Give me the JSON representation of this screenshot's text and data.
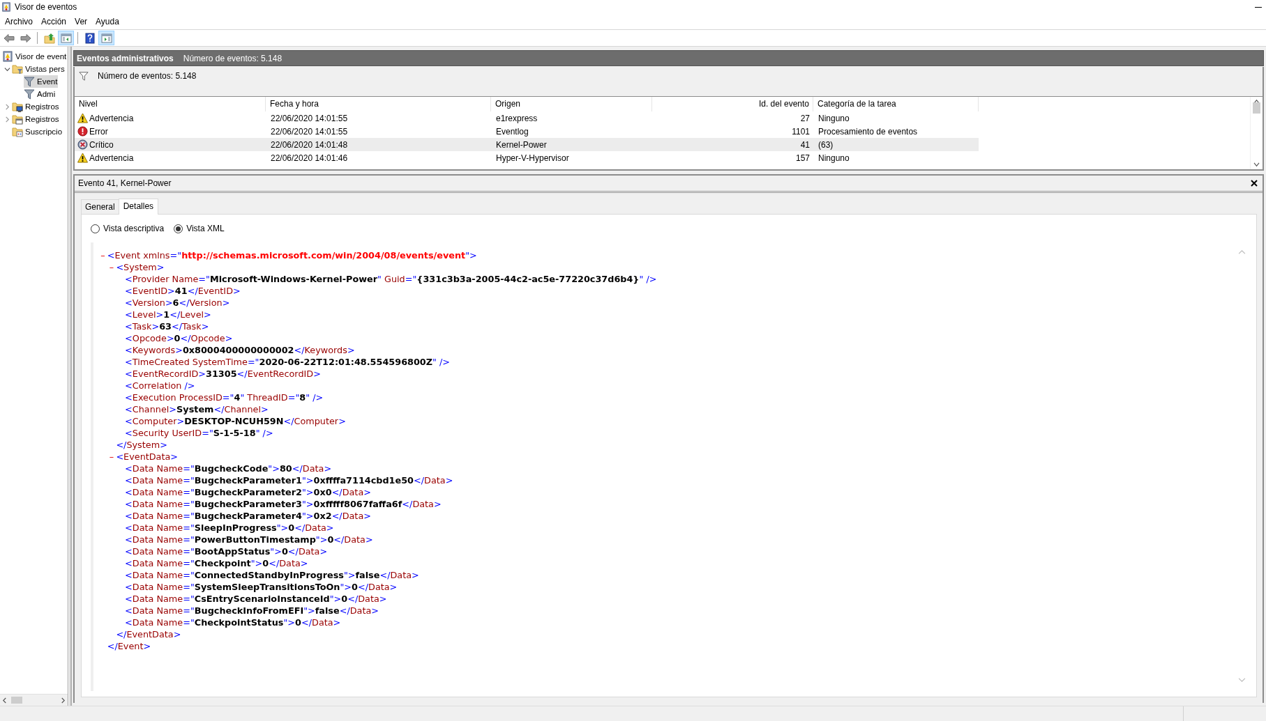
{
  "window": {
    "title": "Visor de eventos"
  },
  "menu": [
    "Archivo",
    "Acción",
    "Ver",
    "Ayuda"
  ],
  "toolbar": [
    {
      "kind": "back",
      "pressed": false
    },
    {
      "kind": "forward",
      "pressed": false
    },
    {
      "kind": "separator"
    },
    {
      "kind": "folder-up",
      "pressed": false
    },
    {
      "kind": "panel-left",
      "pressed": true
    },
    {
      "kind": "separator"
    },
    {
      "kind": "help",
      "pressed": false
    },
    {
      "kind": "panel-right",
      "pressed": true
    }
  ],
  "sidebar": {
    "items": [
      {
        "label": "Visor de event",
        "kind": "viewer",
        "selected": false,
        "children": [
          {
            "label": "Vistas pers",
            "kind": "folder-filter",
            "expanded": true,
            "selected": false,
            "children": [
              {
                "label": "Event",
                "kind": "filter",
                "selected": true
              },
              {
                "label": "Admi",
                "kind": "filter",
                "selected": false
              }
            ]
          },
          {
            "label": "Registros",
            "kind": "folder-log",
            "expanded": false,
            "selected": false
          },
          {
            "label": "Registros",
            "kind": "folder-window",
            "expanded": false,
            "selected": false
          },
          {
            "label": "Suscripcio",
            "kind": "folder-sub",
            "selected": false
          }
        ]
      }
    ]
  },
  "view_header": {
    "title": "Eventos administrativos",
    "count": "Número de eventos: 5.148"
  },
  "filter_bar": {
    "text": "Número de eventos: 5.148"
  },
  "table": {
    "columns": [
      "Nivel",
      "Fecha y hora",
      "Origen",
      "Id. del evento",
      "Categoría de la tarea"
    ],
    "rows": [
      {
        "kind": "warning",
        "selected": false,
        "cells": [
          "Advertencia",
          "22/06/2020 14:01:55",
          "e1rexpress",
          "27",
          "Ninguno"
        ]
      },
      {
        "kind": "error",
        "selected": false,
        "cells": [
          "Error",
          "22/06/2020 14:01:55",
          "Eventlog",
          "1101",
          "Procesamiento de eventos"
        ]
      },
      {
        "kind": "critical",
        "selected": true,
        "cells": [
          "Crítico",
          "22/06/2020 14:01:48",
          "Kernel-Power",
          "41",
          "(63)"
        ]
      },
      {
        "kind": "warning",
        "selected": false,
        "cells": [
          "Advertencia",
          "22/06/2020 14:01:46",
          "Hyper-V-Hypervisor",
          "157",
          "Ninguno"
        ]
      }
    ]
  },
  "detail": {
    "title": "Evento 41, Kernel-Power",
    "tabs": [
      {
        "label": "General",
        "selected": false
      },
      {
        "label": "Detalles",
        "selected": true
      }
    ],
    "views": [
      {
        "label": "Vista descriptiva",
        "selected": false
      },
      {
        "label": "Vista XML",
        "selected": true
      }
    ],
    "xml": {
      "toggle": "–",
      "expanded": true,
      "open": [
        {
          "kind": "mark",
          "text": "<"
        },
        {
          "kind": "name",
          "text": "Event xmlns"
        },
        {
          "kind": "mark",
          "text": "=\""
        },
        {
          "kind": "url",
          "text": "http://schemas.microsoft.com/win/2004/08/events/event"
        },
        {
          "kind": "mark",
          "text": "\">"
        }
      ],
      "close": [
        {
          "kind": "mark",
          "text": "</"
        },
        {
          "kind": "name",
          "text": "Event"
        },
        {
          "kind": "mark",
          "text": ">"
        }
      ],
      "children": [
        {
          "toggle": "–",
          "expanded": true,
          "open": [
            {
              "kind": "mark",
              "text": "<"
            },
            {
              "kind": "name",
              "text": "System"
            },
            {
              "kind": "mark",
              "text": ">"
            }
          ],
          "close": [
            {
              "kind": "mark",
              "text": "</"
            },
            {
              "kind": "name",
              "text": "System"
            },
            {
              "kind": "mark",
              "text": ">"
            }
          ],
          "children": [
            {
              "line": [
                {
                  "kind": "mark",
                  "text": "<"
                },
                {
                  "kind": "name",
                  "text": "Provider Name"
                },
                {
                  "kind": "mark",
                  "text": "=\""
                },
                {
                  "kind": "value",
                  "text": "Microsoft-Windows-Kernel-Power"
                },
                {
                  "kind": "mark",
                  "text": "\" "
                },
                {
                  "kind": "name",
                  "text": "Guid"
                },
                {
                  "kind": "mark",
                  "text": "=\""
                },
                {
                  "kind": "value",
                  "text": "{331c3b3a-2005-44c2-ac5e-77220c37d6b4}"
                },
                {
                  "kind": "mark",
                  "text": "\" />"
                }
              ]
            },
            {
              "line": [
                {
                  "kind": "mark",
                  "text": "<"
                },
                {
                  "kind": "name",
                  "text": "EventID"
                },
                {
                  "kind": "mark",
                  "text": ">"
                },
                {
                  "kind": "value",
                  "text": "41"
                },
                {
                  "kind": "mark",
                  "text": "</"
                },
                {
                  "kind": "name",
                  "text": "EventID"
                },
                {
                  "kind": "mark",
                  "text": ">"
                }
              ]
            },
            {
              "line": [
                {
                  "kind": "mark",
                  "text": "<"
                },
                {
                  "kind": "name",
                  "text": "Version"
                },
                {
                  "kind": "mark",
                  "text": ">"
                },
                {
                  "kind": "value",
                  "text": "6"
                },
                {
                  "kind": "mark",
                  "text": "</"
                },
                {
                  "kind": "name",
                  "text": "Version"
                },
                {
                  "kind": "mark",
                  "text": ">"
                }
              ]
            },
            {
              "line": [
                {
                  "kind": "mark",
                  "text": "<"
                },
                {
                  "kind": "name",
                  "text": "Level"
                },
                {
                  "kind": "mark",
                  "text": ">"
                },
                {
                  "kind": "value",
                  "text": "1"
                },
                {
                  "kind": "mark",
                  "text": "</"
                },
                {
                  "kind": "name",
                  "text": "Level"
                },
                {
                  "kind": "mark",
                  "text": ">"
                }
              ]
            },
            {
              "line": [
                {
                  "kind": "mark",
                  "text": "<"
                },
                {
                  "kind": "name",
                  "text": "Task"
                },
                {
                  "kind": "mark",
                  "text": ">"
                },
                {
                  "kind": "value",
                  "text": "63"
                },
                {
                  "kind": "mark",
                  "text": "</"
                },
                {
                  "kind": "name",
                  "text": "Task"
                },
                {
                  "kind": "mark",
                  "text": ">"
                }
              ]
            },
            {
              "line": [
                {
                  "kind": "mark",
                  "text": "<"
                },
                {
                  "kind": "name",
                  "text": "Opcode"
                },
                {
                  "kind": "mark",
                  "text": ">"
                },
                {
                  "kind": "value",
                  "text": "0"
                },
                {
                  "kind": "mark",
                  "text": "</"
                },
                {
                  "kind": "name",
                  "text": "Opcode"
                },
                {
                  "kind": "mark",
                  "text": ">"
                }
              ]
            },
            {
              "line": [
                {
                  "kind": "mark",
                  "text": "<"
                },
                {
                  "kind": "name",
                  "text": "Keywords"
                },
                {
                  "kind": "mark",
                  "text": ">"
                },
                {
                  "kind": "value",
                  "text": "0x8000400000000002"
                },
                {
                  "kind": "mark",
                  "text": "</"
                },
                {
                  "kind": "name",
                  "text": "Keywords"
                },
                {
                  "kind": "mark",
                  "text": ">"
                }
              ]
            },
            {
              "line": [
                {
                  "kind": "mark",
                  "text": "<"
                },
                {
                  "kind": "name",
                  "text": "TimeCreated SystemTime"
                },
                {
                  "kind": "mark",
                  "text": "=\""
                },
                {
                  "kind": "value",
                  "text": "2020-06-22T12:01:48.554596800Z"
                },
                {
                  "kind": "mark",
                  "text": "\" />"
                }
              ]
            },
            {
              "line": [
                {
                  "kind": "mark",
                  "text": "<"
                },
                {
                  "kind": "name",
                  "text": "EventRecordID"
                },
                {
                  "kind": "mark",
                  "text": ">"
                },
                {
                  "kind": "value",
                  "text": "31305"
                },
                {
                  "kind": "mark",
                  "text": "</"
                },
                {
                  "kind": "name",
                  "text": "EventRecordID"
                },
                {
                  "kind": "mark",
                  "text": ">"
                }
              ]
            },
            {
              "line": [
                {
                  "kind": "mark",
                  "text": "<"
                },
                {
                  "kind": "name",
                  "text": "Correlation"
                },
                {
                  "kind": "mark",
                  "text": " />"
                }
              ]
            },
            {
              "line": [
                {
                  "kind": "mark",
                  "text": "<"
                },
                {
                  "kind": "name",
                  "text": "Execution ProcessID"
                },
                {
                  "kind": "mark",
                  "text": "=\""
                },
                {
                  "kind": "value",
                  "text": "4"
                },
                {
                  "kind": "mark",
                  "text": "\" "
                },
                {
                  "kind": "name",
                  "text": "ThreadID"
                },
                {
                  "kind": "mark",
                  "text": "=\""
                },
                {
                  "kind": "value",
                  "text": "8"
                },
                {
                  "kind": "mark",
                  "text": "\" />"
                }
              ]
            },
            {
              "line": [
                {
                  "kind": "mark",
                  "text": "<"
                },
                {
                  "kind": "name",
                  "text": "Channel"
                },
                {
                  "kind": "mark",
                  "text": ">"
                },
                {
                  "kind": "value",
                  "text": "System"
                },
                {
                  "kind": "mark",
                  "text": "</"
                },
                {
                  "kind": "name",
                  "text": "Channel"
                },
                {
                  "kind": "mark",
                  "text": ">"
                }
              ]
            },
            {
              "line": [
                {
                  "kind": "mark",
                  "text": "<"
                },
                {
                  "kind": "name",
                  "text": "Computer"
                },
                {
                  "kind": "mark",
                  "text": ">"
                },
                {
                  "kind": "value",
                  "text": "DESKTOP-NCUH59N"
                },
                {
                  "kind": "mark",
                  "text": "</"
                },
                {
                  "kind": "name",
                  "text": "Computer"
                },
                {
                  "kind": "mark",
                  "text": ">"
                }
              ]
            },
            {
              "line": [
                {
                  "kind": "mark",
                  "text": "<"
                },
                {
                  "kind": "name",
                  "text": "Security UserID"
                },
                {
                  "kind": "mark",
                  "text": "=\""
                },
                {
                  "kind": "value",
                  "text": "S-1-5-18"
                },
                {
                  "kind": "mark",
                  "text": "\" />"
                }
              ]
            }
          ]
        },
        {
          "toggle": "–",
          "expanded": true,
          "open": [
            {
              "kind": "mark",
              "text": "<"
            },
            {
              "kind": "name",
              "text": "EventData"
            },
            {
              "kind": "mark",
              "text": ">"
            }
          ],
          "close": [
            {
              "kind": "mark",
              "text": "</"
            },
            {
              "kind": "name",
              "text": "EventData"
            },
            {
              "kind": "mark",
              "text": ">"
            }
          ],
          "children": [
            {
              "line": [
                {
                  "kind": "mark",
                  "text": "<"
                },
                {
                  "kind": "name",
                  "text": "Data Name"
                },
                {
                  "kind": "mark",
                  "text": "=\""
                },
                {
                  "kind": "value",
                  "text": "BugcheckCode"
                },
                {
                  "kind": "mark",
                  "text": "\">"
                },
                {
                  "kind": "value",
                  "text": "80"
                },
                {
                  "kind": "mark",
                  "text": "</"
                },
                {
                  "kind": "name",
                  "text": "Data"
                },
                {
                  "kind": "mark",
                  "text": ">"
                }
              ]
            },
            {
              "line": [
                {
                  "kind": "mark",
                  "text": "<"
                },
                {
                  "kind": "name",
                  "text": "Data Name"
                },
                {
                  "kind": "mark",
                  "text": "=\""
                },
                {
                  "kind": "value",
                  "text": "BugcheckParameter1"
                },
                {
                  "kind": "mark",
                  "text": "\">"
                },
                {
                  "kind": "value",
                  "text": "0xffffa7114cbd1e50"
                },
                {
                  "kind": "mark",
                  "text": "</"
                },
                {
                  "kind": "name",
                  "text": "Data"
                },
                {
                  "kind": "mark",
                  "text": ">"
                }
              ]
            },
            {
              "line": [
                {
                  "kind": "mark",
                  "text": "<"
                },
                {
                  "kind": "name",
                  "text": "Data Name"
                },
                {
                  "kind": "mark",
                  "text": "=\""
                },
                {
                  "kind": "value",
                  "text": "BugcheckParameter2"
                },
                {
                  "kind": "mark",
                  "text": "\">"
                },
                {
                  "kind": "value",
                  "text": "0x0"
                },
                {
                  "kind": "mark",
                  "text": "</"
                },
                {
                  "kind": "name",
                  "text": "Data"
                },
                {
                  "kind": "mark",
                  "text": ">"
                }
              ]
            },
            {
              "line": [
                {
                  "kind": "mark",
                  "text": "<"
                },
                {
                  "kind": "name",
                  "text": "Data Name"
                },
                {
                  "kind": "mark",
                  "text": "=\""
                },
                {
                  "kind": "value",
                  "text": "BugcheckParameter3"
                },
                {
                  "kind": "mark",
                  "text": "\">"
                },
                {
                  "kind": "value",
                  "text": "0xfffff8067faffa6f"
                },
                {
                  "kind": "mark",
                  "text": "</"
                },
                {
                  "kind": "name",
                  "text": "Data"
                },
                {
                  "kind": "mark",
                  "text": ">"
                }
              ]
            },
            {
              "line": [
                {
                  "kind": "mark",
                  "text": "<"
                },
                {
                  "kind": "name",
                  "text": "Data Name"
                },
                {
                  "kind": "mark",
                  "text": "=\""
                },
                {
                  "kind": "value",
                  "text": "BugcheckParameter4"
                },
                {
                  "kind": "mark",
                  "text": "\">"
                },
                {
                  "kind": "value",
                  "text": "0x2"
                },
                {
                  "kind": "mark",
                  "text": "</"
                },
                {
                  "kind": "name",
                  "text": "Data"
                },
                {
                  "kind": "mark",
                  "text": ">"
                }
              ]
            },
            {
              "line": [
                {
                  "kind": "mark",
                  "text": "<"
                },
                {
                  "kind": "name",
                  "text": "Data Name"
                },
                {
                  "kind": "mark",
                  "text": "=\""
                },
                {
                  "kind": "value",
                  "text": "SleepInProgress"
                },
                {
                  "kind": "mark",
                  "text": "\">"
                },
                {
                  "kind": "value",
                  "text": "0"
                },
                {
                  "kind": "mark",
                  "text": "</"
                },
                {
                  "kind": "name",
                  "text": "Data"
                },
                {
                  "kind": "mark",
                  "text": ">"
                }
              ]
            },
            {
              "line": [
                {
                  "kind": "mark",
                  "text": "<"
                },
                {
                  "kind": "name",
                  "text": "Data Name"
                },
                {
                  "kind": "mark",
                  "text": "=\""
                },
                {
                  "kind": "value",
                  "text": "PowerButtonTimestamp"
                },
                {
                  "kind": "mark",
                  "text": "\">"
                },
                {
                  "kind": "value",
                  "text": "0"
                },
                {
                  "kind": "mark",
                  "text": "</"
                },
                {
                  "kind": "name",
                  "text": "Data"
                },
                {
                  "kind": "mark",
                  "text": ">"
                }
              ]
            },
            {
              "line": [
                {
                  "kind": "mark",
                  "text": "<"
                },
                {
                  "kind": "name",
                  "text": "Data Name"
                },
                {
                  "kind": "mark",
                  "text": "=\""
                },
                {
                  "kind": "value",
                  "text": "BootAppStatus"
                },
                {
                  "kind": "mark",
                  "text": "\">"
                },
                {
                  "kind": "value",
                  "text": "0"
                },
                {
                  "kind": "mark",
                  "text": "</"
                },
                {
                  "kind": "name",
                  "text": "Data"
                },
                {
                  "kind": "mark",
                  "text": ">"
                }
              ]
            },
            {
              "line": [
                {
                  "kind": "mark",
                  "text": "<"
                },
                {
                  "kind": "name",
                  "text": "Data Name"
                },
                {
                  "kind": "mark",
                  "text": "=\""
                },
                {
                  "kind": "value",
                  "text": "Checkpoint"
                },
                {
                  "kind": "mark",
                  "text": "\">"
                },
                {
                  "kind": "value",
                  "text": "0"
                },
                {
                  "kind": "mark",
                  "text": "</"
                },
                {
                  "kind": "name",
                  "text": "Data"
                },
                {
                  "kind": "mark",
                  "text": ">"
                }
              ]
            },
            {
              "line": [
                {
                  "kind": "mark",
                  "text": "<"
                },
                {
                  "kind": "name",
                  "text": "Data Name"
                },
                {
                  "kind": "mark",
                  "text": "=\""
                },
                {
                  "kind": "value",
                  "text": "ConnectedStandbyInProgress"
                },
                {
                  "kind": "mark",
                  "text": "\">"
                },
                {
                  "kind": "value",
                  "text": "false"
                },
                {
                  "kind": "mark",
                  "text": "</"
                },
                {
                  "kind": "name",
                  "text": "Data"
                },
                {
                  "kind": "mark",
                  "text": ">"
                }
              ]
            },
            {
              "line": [
                {
                  "kind": "mark",
                  "text": "<"
                },
                {
                  "kind": "name",
                  "text": "Data Name"
                },
                {
                  "kind": "mark",
                  "text": "=\""
                },
                {
                  "kind": "value",
                  "text": "SystemSleepTransitionsToOn"
                },
                {
                  "kind": "mark",
                  "text": "\">"
                },
                {
                  "kind": "value",
                  "text": "0"
                },
                {
                  "kind": "mark",
                  "text": "</"
                },
                {
                  "kind": "name",
                  "text": "Data"
                },
                {
                  "kind": "mark",
                  "text": ">"
                }
              ]
            },
            {
              "line": [
                {
                  "kind": "mark",
                  "text": "<"
                },
                {
                  "kind": "name",
                  "text": "Data Name"
                },
                {
                  "kind": "mark",
                  "text": "=\""
                },
                {
                  "kind": "value",
                  "text": "CsEntryScenarioInstanceId"
                },
                {
                  "kind": "mark",
                  "text": "\">"
                },
                {
                  "kind": "value",
                  "text": "0"
                },
                {
                  "kind": "mark",
                  "text": "</"
                },
                {
                  "kind": "name",
                  "text": "Data"
                },
                {
                  "kind": "mark",
                  "text": ">"
                }
              ]
            },
            {
              "line": [
                {
                  "kind": "mark",
                  "text": "<"
                },
                {
                  "kind": "name",
                  "text": "Data Name"
                },
                {
                  "kind": "mark",
                  "text": "=\""
                },
                {
                  "kind": "value",
                  "text": "BugcheckInfoFromEFI"
                },
                {
                  "kind": "mark",
                  "text": "\">"
                },
                {
                  "kind": "value",
                  "text": "false"
                },
                {
                  "kind": "mark",
                  "text": "</"
                },
                {
                  "kind": "name",
                  "text": "Data"
                },
                {
                  "kind": "mark",
                  "text": ">"
                }
              ]
            },
            {
              "line": [
                {
                  "kind": "mark",
                  "text": "<"
                },
                {
                  "kind": "name",
                  "text": "Data Name"
                },
                {
                  "kind": "mark",
                  "text": "=\""
                },
                {
                  "kind": "value",
                  "text": "CheckpointStatus"
                },
                {
                  "kind": "mark",
                  "text": "\">"
                },
                {
                  "kind": "value",
                  "text": "0"
                },
                {
                  "kind": "mark",
                  "text": "</"
                },
                {
                  "kind": "name",
                  "text": "Data"
                },
                {
                  "kind": "mark",
                  "text": ">"
                }
              ]
            }
          ]
        }
      ]
    }
  }
}
